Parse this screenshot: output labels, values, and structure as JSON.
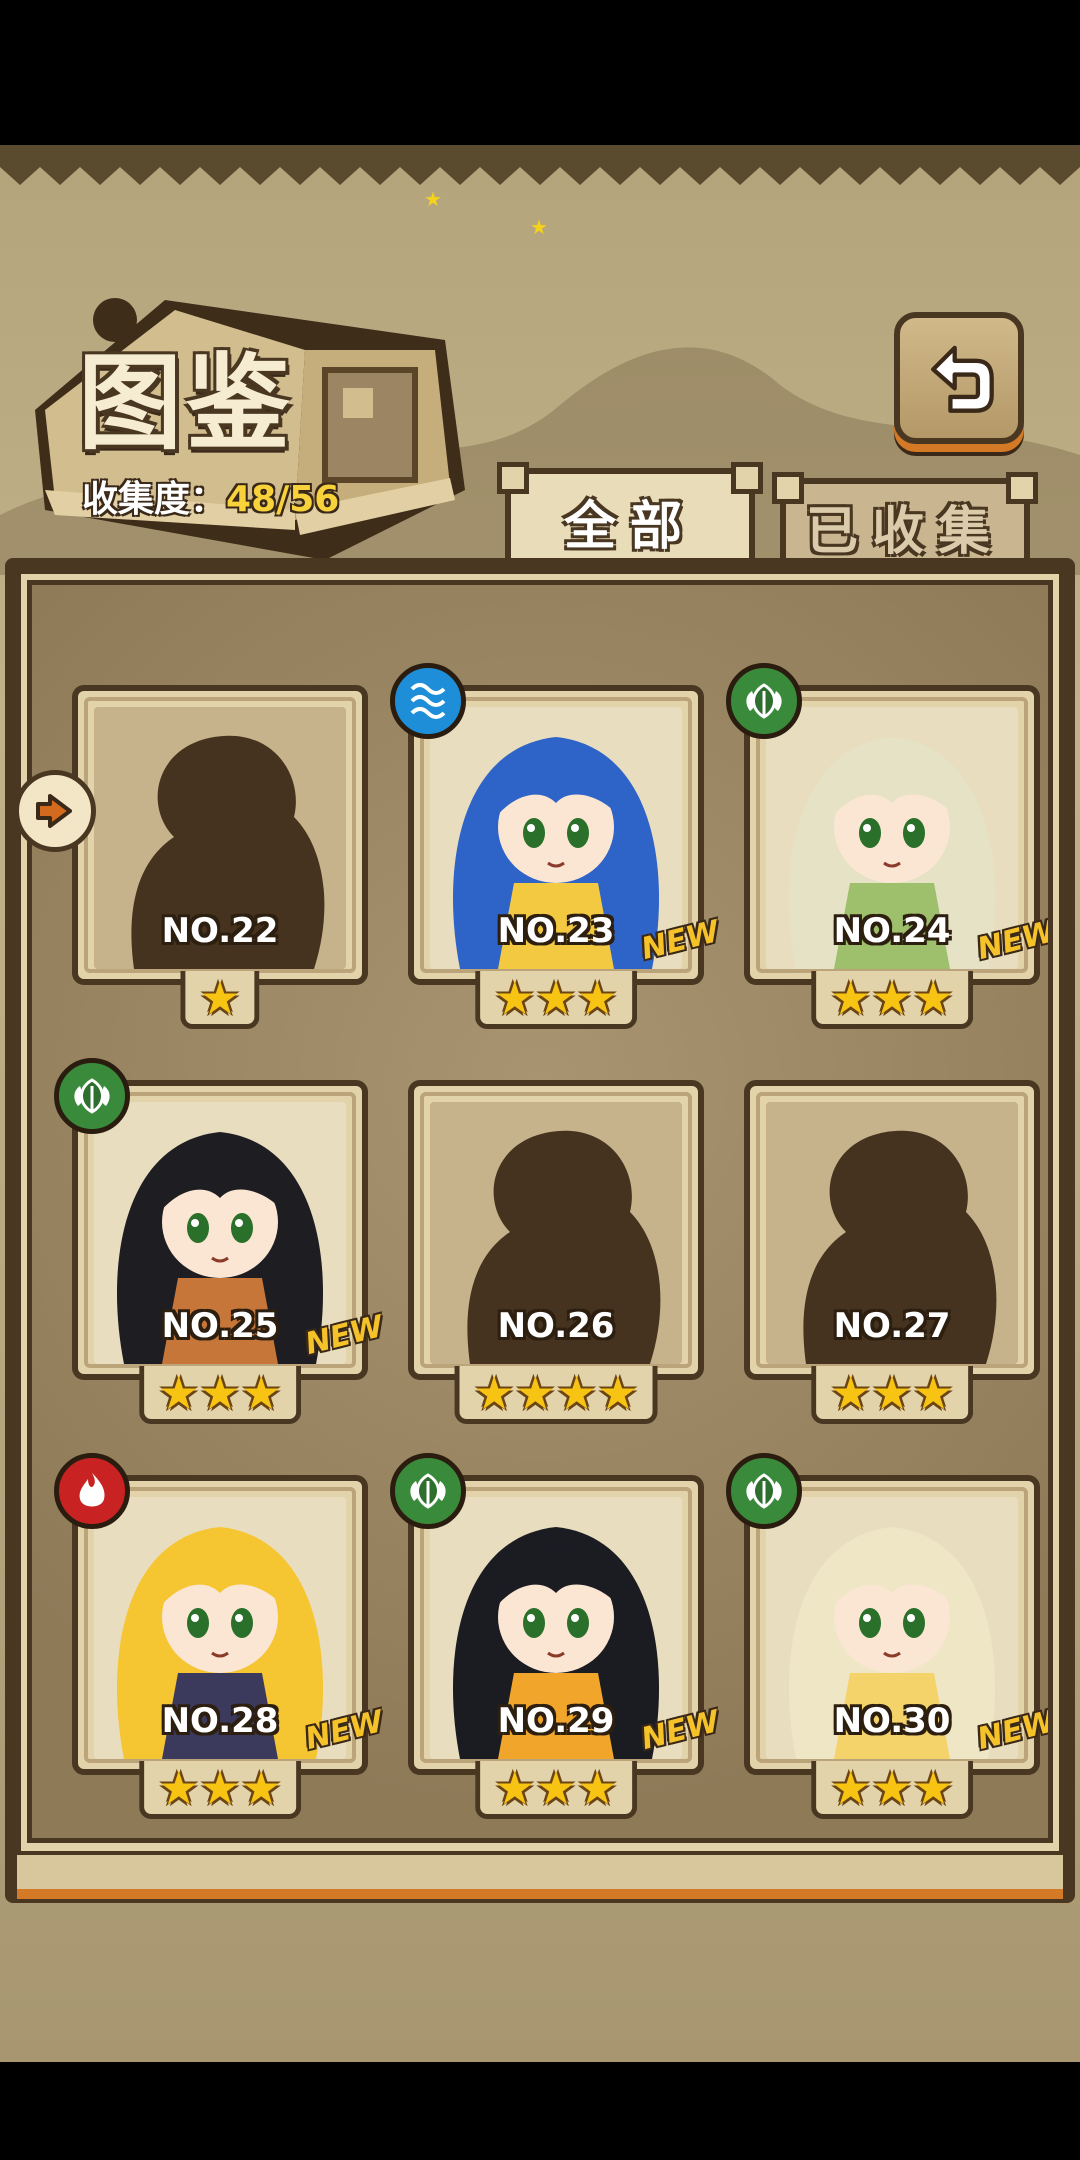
{
  "title": "图鉴",
  "collection": {
    "label": "收集度：",
    "value": "48/56"
  },
  "tabs": {
    "all": "全部",
    "collected": "已收集"
  },
  "cards": [
    {
      "number": "NO.22",
      "stars": "★",
      "element": "",
      "new": "",
      "locked": true,
      "palette": {
        "hair": "",
        "accent": ""
      }
    },
    {
      "number": "NO.23",
      "stars": "★★★",
      "element": "water",
      "new": "NEW",
      "locked": false,
      "palette": {
        "hair": "#2e63c8",
        "accent": "#f3c941"
      }
    },
    {
      "number": "NO.24",
      "stars": "★★★",
      "element": "leaf",
      "new": "NEW",
      "locked": false,
      "palette": {
        "hair": "#e5e2c6",
        "accent": "#9ebf6b"
      }
    },
    {
      "number": "NO.25",
      "stars": "★★★",
      "element": "leaf",
      "new": "NEW",
      "locked": false,
      "palette": {
        "hair": "#1d1d22",
        "accent": "#c7763a"
      }
    },
    {
      "number": "NO.26",
      "stars": "★★★★",
      "element": "",
      "new": "",
      "locked": true,
      "palette": {
        "hair": "",
        "accent": ""
      }
    },
    {
      "number": "NO.27",
      "stars": "★★★",
      "element": "",
      "new": "",
      "locked": true,
      "palette": {
        "hair": "",
        "accent": ""
      }
    },
    {
      "number": "NO.28",
      "stars": "★★★",
      "element": "fire",
      "new": "NEW",
      "locked": false,
      "palette": {
        "hair": "#f6c532",
        "accent": "#3b3a5c"
      }
    },
    {
      "number": "NO.29",
      "stars": "★★★",
      "element": "leaf",
      "new": "NEW",
      "locked": false,
      "palette": {
        "hair": "#1b1b22",
        "accent": "#f2a52b"
      }
    },
    {
      "number": "NO.30",
      "stars": "★★★",
      "element": "leaf",
      "new": "NEW",
      "locked": false,
      "palette": {
        "hair": "#efe6c6",
        "accent": "#f4d36a"
      }
    }
  ],
  "colors": {
    "frame": "#4a3722",
    "parchment": "#e3d3ab",
    "star": "#f8c414",
    "new": "#f6c229"
  },
  "icons": {
    "back": "back-arrow-icon",
    "side": "turn-arrow-icon",
    "water": "water-element-icon",
    "leaf": "leaf-element-icon",
    "fire": "fire-element-icon"
  }
}
